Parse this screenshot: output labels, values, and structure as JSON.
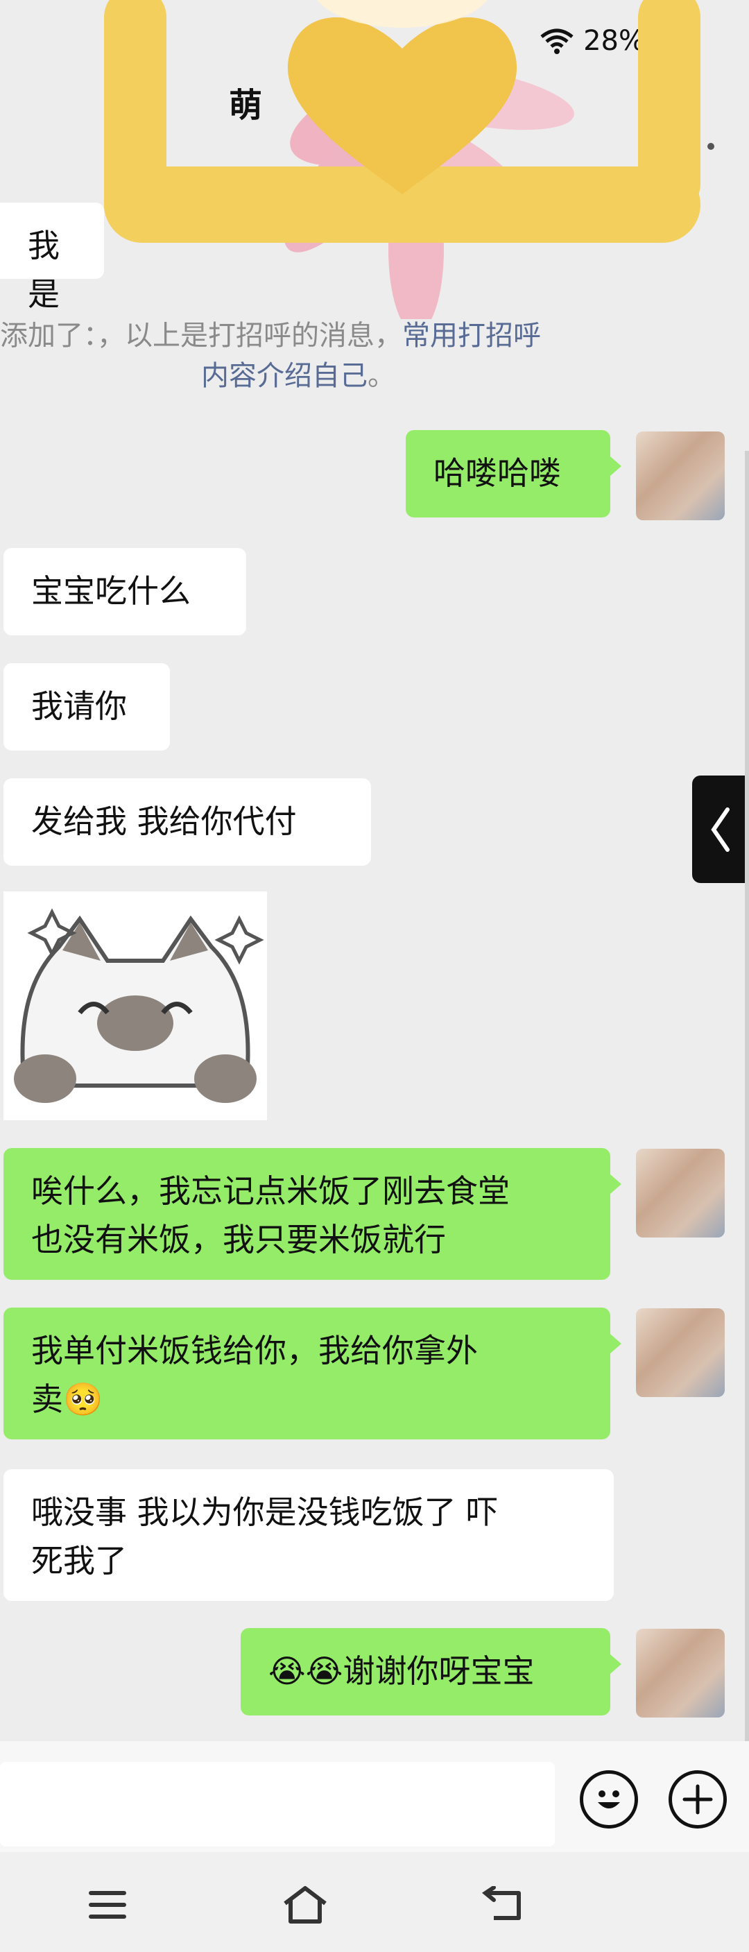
{
  "status_bar": {
    "battery": "28%"
  },
  "header": {
    "title": "萌",
    "subtitle": ""
  },
  "system_message": {
    "line1": "添加了：，以上是打招呼的消息，",
    "line1_link": "常用打招呼",
    "line2_link": "内容介绍自己",
    "line2_end": "。"
  },
  "messages": [
    {
      "id": "m0",
      "direction": "in",
      "text": "我是"
    },
    {
      "id": "m1",
      "direction": "out",
      "text": "哈喽哈喽"
    },
    {
      "id": "m2",
      "direction": "in",
      "text": "宝宝吃什么"
    },
    {
      "id": "m3",
      "direction": "in",
      "text": "我请你"
    },
    {
      "id": "m4",
      "direction": "in",
      "text": "发给我 我给你代付"
    },
    {
      "id": "m5",
      "direction": "in",
      "type": "sticker",
      "sticker": "cat-smiling-sticker"
    },
    {
      "id": "m6",
      "direction": "out",
      "line1": "唉什么，我忘记点米饭了刚去食堂",
      "line2": "也没有米饭，我只要米饭就行"
    },
    {
      "id": "m7",
      "direction": "out",
      "line1": "我单付米饭钱给你，我给你拿外",
      "line2": "卖🥺"
    },
    {
      "id": "m8",
      "direction": "in",
      "line1": "哦没事 我以为你是没钱吃饭了 吓",
      "line2": "死我了"
    },
    {
      "id": "m9",
      "direction": "out",
      "text": "😭😭谢谢你呀宝宝"
    }
  ],
  "input_bar": {
    "emoji_icon": "emoji-icon",
    "plus_icon": "plus-icon"
  },
  "nav_bar": {
    "menu_icon": "menu-icon",
    "home_icon": "home-icon",
    "back_icon": "back-icon"
  },
  "colors": {
    "outgoing_bubble": "#95ec69",
    "incoming_bubble": "#ffffff",
    "background": "#ededed",
    "link": "#576b95"
  }
}
